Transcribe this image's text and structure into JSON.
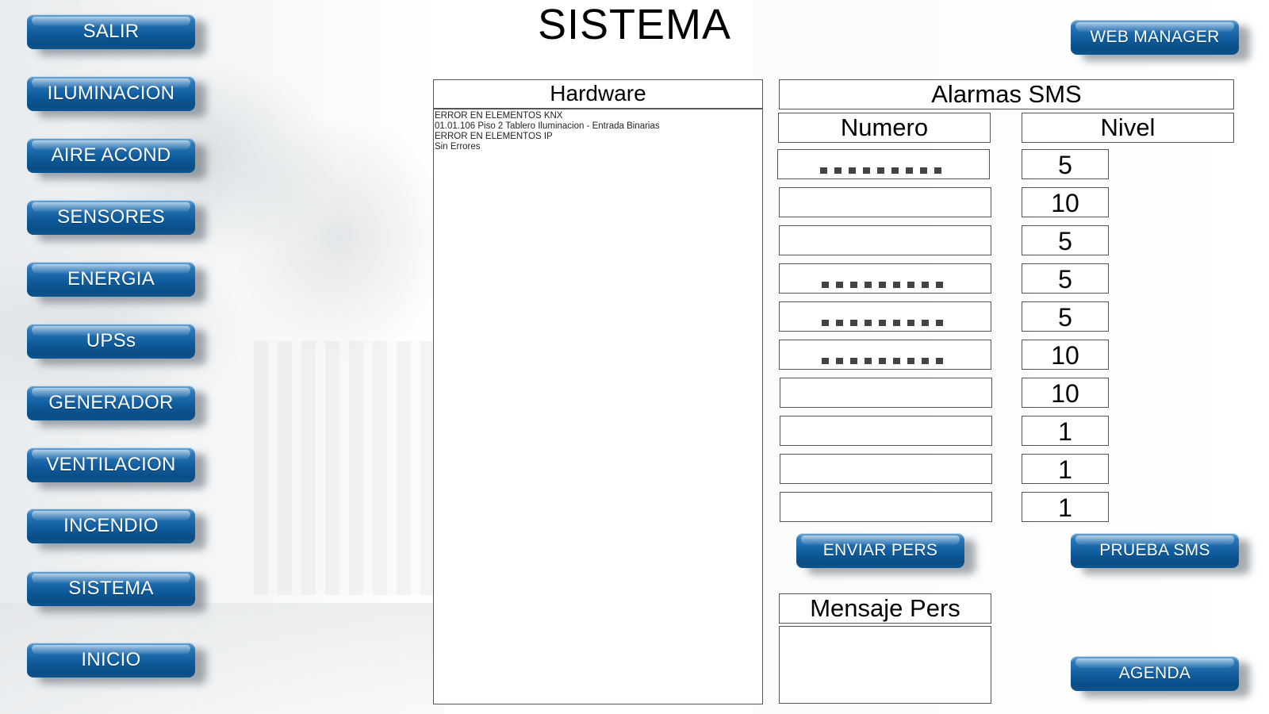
{
  "page": {
    "title": "SISTEMA"
  },
  "nav": {
    "items": [
      {
        "id": "salir",
        "label": "SALIR"
      },
      {
        "id": "iluminacion",
        "label": "ILUMINACION"
      },
      {
        "id": "aire-acond",
        "label": "AIRE ACOND"
      },
      {
        "id": "sensores",
        "label": "SENSORES"
      },
      {
        "id": "energia",
        "label": "ENERGIA"
      },
      {
        "id": "upss",
        "label": "UPSs"
      },
      {
        "id": "generador",
        "label": "GENERADOR"
      },
      {
        "id": "ventilacion",
        "label": "VENTILACION"
      },
      {
        "id": "incendio",
        "label": "INCENDIO"
      },
      {
        "id": "sistema",
        "label": "SISTEMA"
      },
      {
        "id": "inicio",
        "label": "INICIO"
      }
    ]
  },
  "top_right": {
    "web_manager_label": "WEB MANAGER"
  },
  "hardware": {
    "header": "Hardware",
    "log_lines": [
      "ERROR EN ELEMENTOS KNX",
      "01.01.106 Piso 2 Tablero Iluminacion - Entrada Binarias",
      "ERROR EN ELEMENTOS IP",
      "Sin Errores"
    ]
  },
  "alarmas": {
    "header": "Alarmas SMS",
    "numero_header": "Numero",
    "nivel_header": "Nivel",
    "rows": [
      {
        "numero": "",
        "masked": true,
        "nivel": "5"
      },
      {
        "numero": "",
        "masked": false,
        "nivel": "10"
      },
      {
        "numero": "",
        "masked": false,
        "nivel": "5"
      },
      {
        "numero": "",
        "masked": true,
        "nivel": "5"
      },
      {
        "numero": "",
        "masked": true,
        "nivel": "5"
      },
      {
        "numero": "",
        "masked": true,
        "nivel": "10"
      },
      {
        "numero": "",
        "masked": false,
        "nivel": "10"
      },
      {
        "numero": "",
        "masked": false,
        "nivel": "1"
      },
      {
        "numero": "",
        "masked": false,
        "nivel": "1"
      },
      {
        "numero": "",
        "masked": false,
        "nivel": "1"
      }
    ],
    "enviar_pers_label": "ENVIAR PERS",
    "prueba_sms_label": "PRUEBA SMS",
    "mensaje_header": "Mensaje Pers",
    "mensaje_value": "",
    "agenda_label": "AGENDA"
  },
  "colors": {
    "button_blue": "#0f5c9e",
    "button_text": "#ffffff",
    "border": "#555555"
  }
}
